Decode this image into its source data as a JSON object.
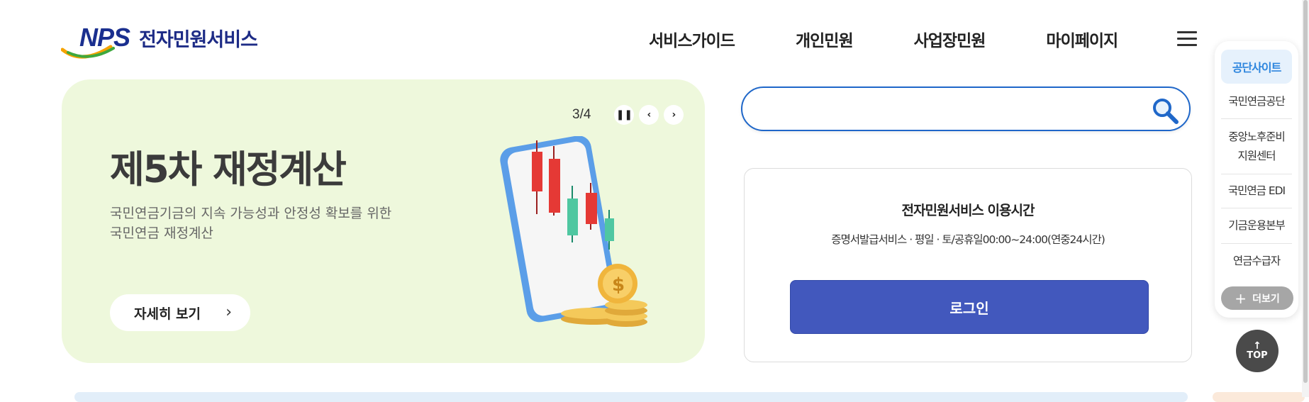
{
  "header": {
    "logo_mark": "NPS",
    "logo_title": "전자민원서비스",
    "nav": [
      "서비스가이드",
      "개인민원",
      "사업장민원",
      "마이페이지"
    ]
  },
  "banner": {
    "pager": "3/4",
    "title": "제5차 재정계산",
    "desc_line1": "국민연금기금의 지속 가능성과 안정성 확보를 위한",
    "desc_line2": "국민연금 재정계산",
    "detail_label": "자세히 보기",
    "bg_color": "#eef8dc"
  },
  "search": {
    "value": "",
    "placeholder": ""
  },
  "info": {
    "title": "전자민원서비스 이용시간",
    "desc": "증명서발급서비스 · 평일 · 토/공휴일00:00~24:00(연중24시간)",
    "login_label": "로그인",
    "login_color": "#4258bd"
  },
  "quick": {
    "head": "공단사이트",
    "items": [
      "국민연금공단",
      "중앙노후준비\n지원센터",
      "국민연금 EDI",
      "기금운용본부",
      "연금수급자"
    ],
    "more": "더보기"
  },
  "top_label": "TOP"
}
